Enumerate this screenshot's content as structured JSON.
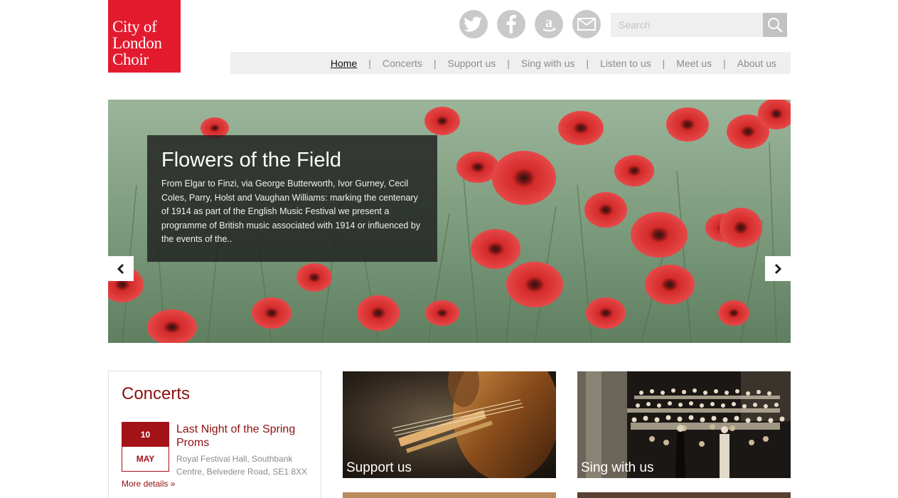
{
  "logo": {
    "line1": "City of",
    "line2": "London",
    "line3": "Choir"
  },
  "social": [
    {
      "icon": "twitter-icon"
    },
    {
      "icon": "facebook-icon"
    },
    {
      "icon": "amazon-icon"
    },
    {
      "icon": "mail-icon"
    }
  ],
  "search": {
    "placeholder": "Search",
    "icon": "search-icon"
  },
  "nav": {
    "items": [
      {
        "label": "Home",
        "active": true
      },
      {
        "label": "Concerts"
      },
      {
        "label": "Support us"
      },
      {
        "label": "Sing with us"
      },
      {
        "label": "Listen to us"
      },
      {
        "label": "Meet us"
      },
      {
        "label": "About us"
      }
    ],
    "separator": "|"
  },
  "hero": {
    "title": "Flowers of the Field",
    "text": "From Elgar to Finzi, via George Butterworth, Ivor Gurney, Cecil Coles, Parry, Holst and Vaughan Williams: marking the centenary of 1914 as part of the English Music Festival we present a programme of British music associated with 1914 or influenced by the events of the..",
    "prev_icon": "chevron-left-icon",
    "next_icon": "chevron-right-icon"
  },
  "concerts": {
    "heading": "Concerts",
    "event": {
      "day": "10",
      "month": "MAY",
      "title": "Last Night of the Spring Proms",
      "venue": "Royal Festival Hall, Southbank Centre, Belvedere Road, SE1 8XX",
      "more": "More details »"
    }
  },
  "tiles": [
    {
      "label": "Support us"
    },
    {
      "label": "Sing with us"
    }
  ],
  "colors": {
    "brand_red": "#e31a2e",
    "dark_red": "#8e1011",
    "nav_bg": "#efefef"
  }
}
